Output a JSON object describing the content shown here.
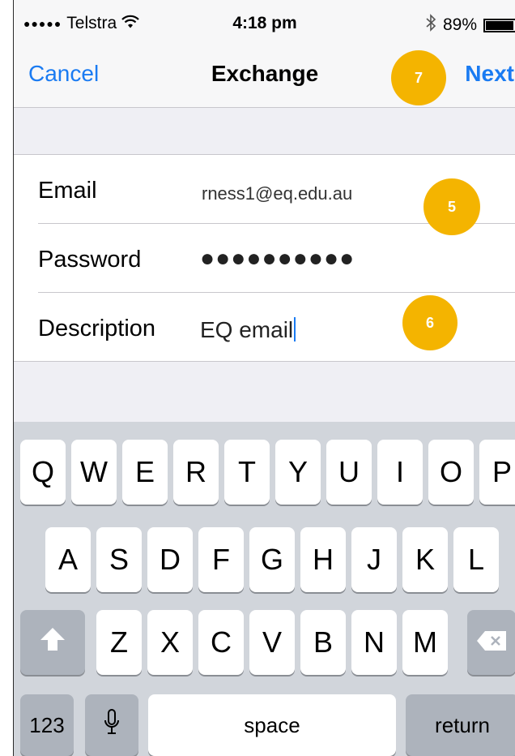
{
  "status_bar": {
    "signal_dots": "●●●●●",
    "carrier": "Telstra",
    "wifi_icon": "wifi-icon",
    "time": "4:18 pm",
    "bluetooth_icon": "bluetooth-icon",
    "battery_text": "89%",
    "battery_level": 0.89
  },
  "nav": {
    "cancel_label": "Cancel",
    "title": "Exchange",
    "next_label": "Next"
  },
  "form": {
    "email_label": "Email",
    "email_value": "rness1@eq.edu.au",
    "password_label": "Password",
    "password_value": "●●●●●●●●●●",
    "description_label": "Description",
    "description_value": "EQ email"
  },
  "annotations": {
    "step_5": "5",
    "step_6": "6",
    "step_7": "7"
  },
  "keyboard": {
    "row1": [
      "Q",
      "W",
      "E",
      "R",
      "T",
      "Y",
      "U",
      "I",
      "O",
      "P"
    ],
    "row2": [
      "A",
      "S",
      "D",
      "F",
      "G",
      "H",
      "J",
      "K",
      "L"
    ],
    "row3": [
      "Z",
      "X",
      "C",
      "V",
      "B",
      "N",
      "M"
    ],
    "numbers_label": "123",
    "space_label": "space",
    "return_label": "return",
    "shift_icon": "shift-arrow-icon",
    "delete_icon": "backspace-icon",
    "mic_icon": "microphone-icon"
  },
  "colors": {
    "accent": "#1a7bf2",
    "badge": "#f4b400"
  }
}
